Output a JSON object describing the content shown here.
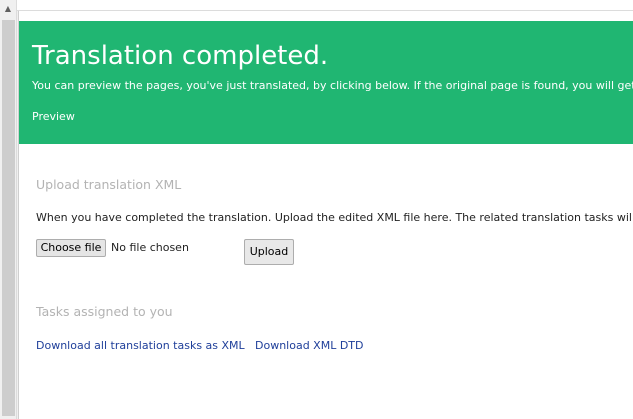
{
  "scrollbar": {
    "up_arrow_icon": "triangle-up"
  },
  "banner": {
    "title": "Translation completed.",
    "description": "You can preview the pages, you've just translated, by clicking below. If the original page is found, you will get a",
    "preview_link": "Preview",
    "color": "#20b672"
  },
  "upload_section": {
    "heading": "Upload translation XML",
    "instructions": "When you have completed the translation. Upload the edited XML file here. The related translation tasks will a",
    "choose_file_label": "Choose file",
    "file_status": "No file chosen",
    "upload_label": "Upload"
  },
  "tasks_section": {
    "heading": "Tasks assigned to you",
    "download_tasks_link": "Download all translation tasks as XML",
    "download_dtd_link": "Download XML DTD",
    "link_color": "#1f3f9a"
  }
}
